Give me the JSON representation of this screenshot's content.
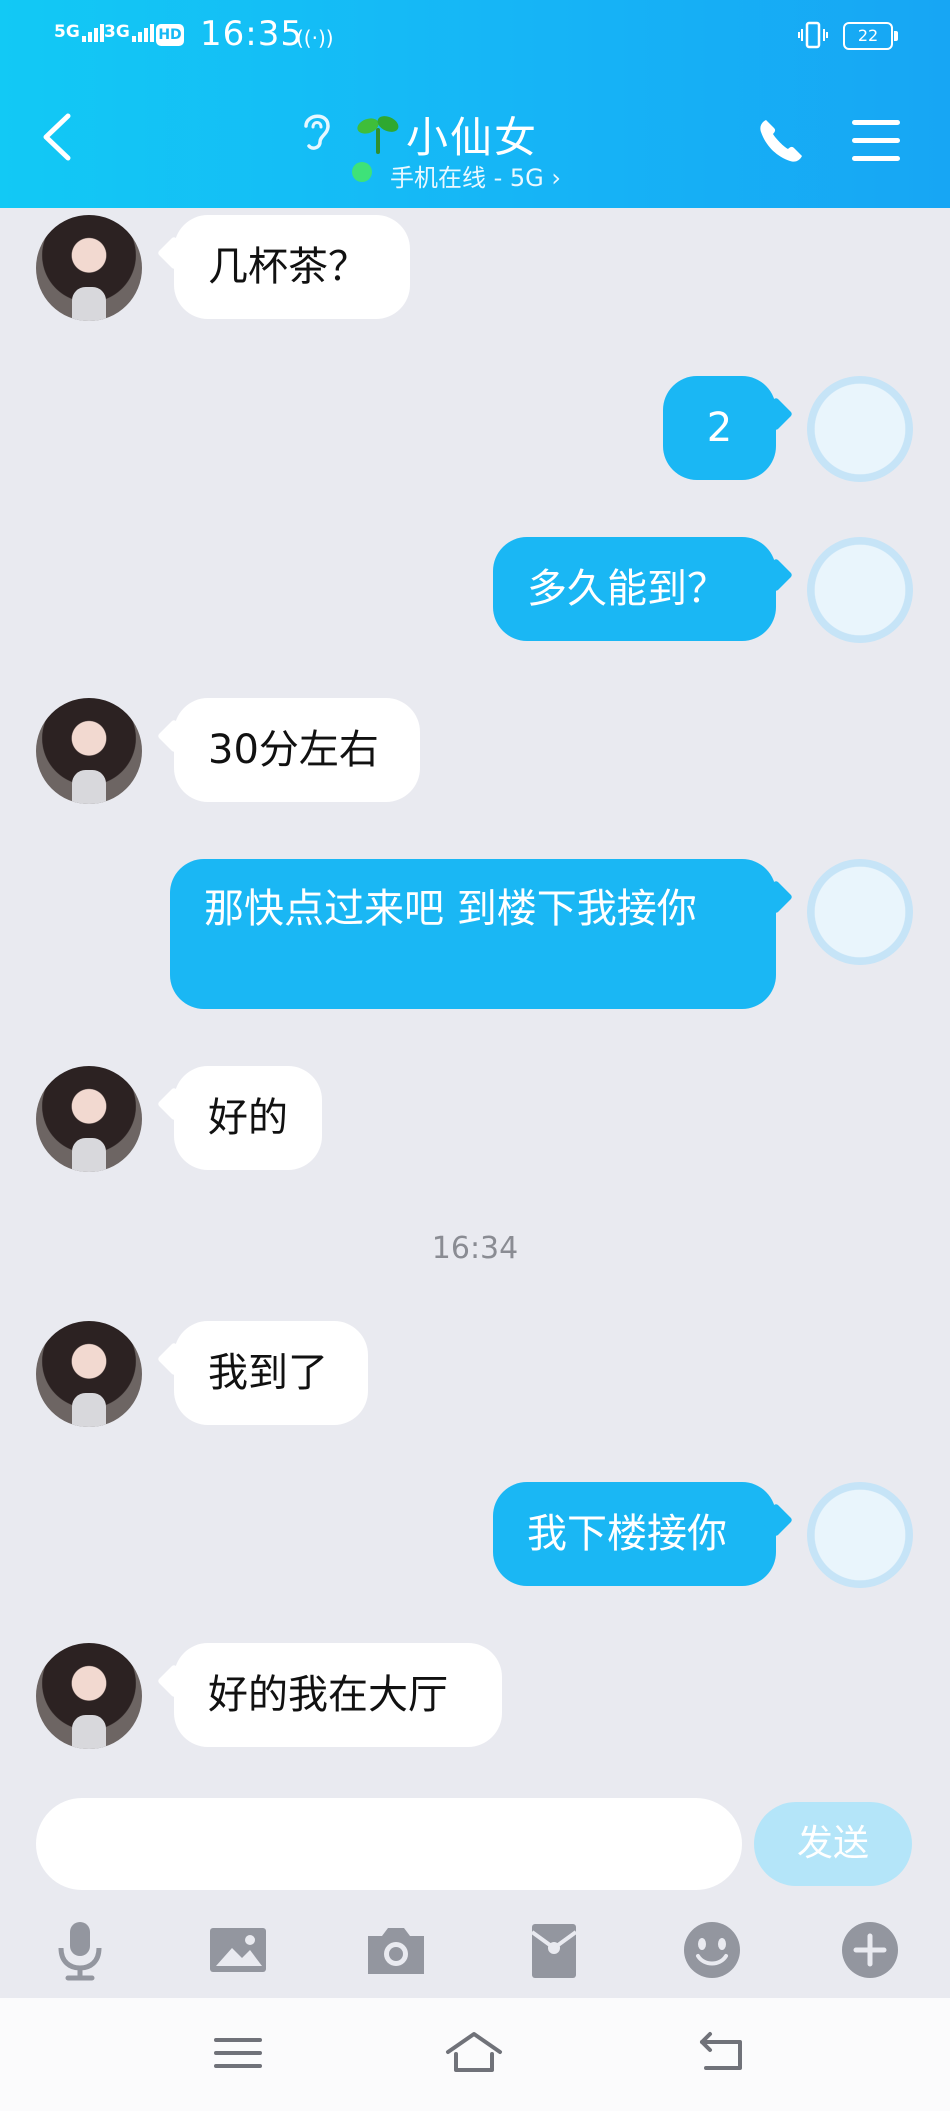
{
  "status_bar": {
    "net1": "5G",
    "net2": "3G",
    "hd": "HD",
    "time": "16:35",
    "battery": "22"
  },
  "header": {
    "contact_name": "小仙女",
    "status": "手机在线 - 5G ›"
  },
  "colors": {
    "header": "#16b5f6",
    "outgoing_bubble": "#1ab7f4",
    "incoming_bubble": "#ffffff",
    "online": "#3ee279",
    "send_disabled": "#b4e5f9"
  },
  "messages": [
    {
      "from": "them",
      "text": "几杯茶？"
    },
    {
      "from": "me",
      "text": "2"
    },
    {
      "from": "me",
      "text": "多久能到？"
    },
    {
      "from": "them",
      "text": "30分左右"
    },
    {
      "from": "me",
      "text": "那快点过来吧 到楼下我接你"
    },
    {
      "from": "them",
      "text": "好的"
    },
    {
      "type": "time",
      "text": "16:34"
    },
    {
      "from": "them",
      "text": "我到了"
    },
    {
      "from": "me",
      "text": "我下楼接你"
    },
    {
      "from": "them",
      "text": "好的我在大厅"
    }
  ],
  "composer": {
    "placeholder": "",
    "send_label": "发送"
  },
  "toolbar_icons": [
    "microphone-icon",
    "image-icon",
    "camera-icon",
    "red-packet-icon",
    "emoji-icon",
    "plus-icon"
  ],
  "nav_icons": [
    "menu-icon",
    "home-icon",
    "back-icon"
  ]
}
